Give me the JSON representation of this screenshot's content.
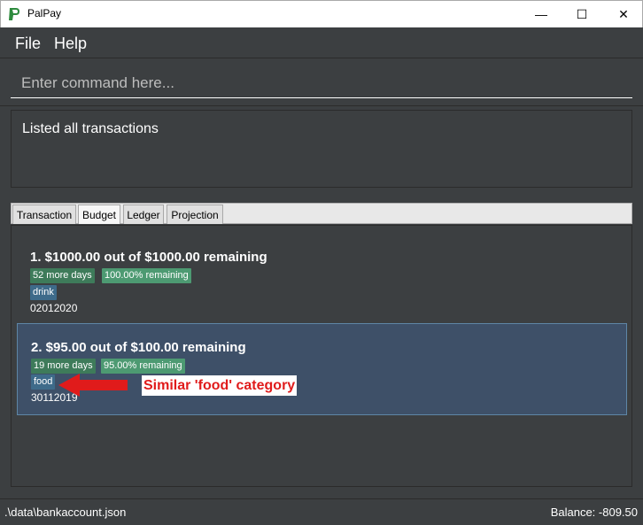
{
  "window": {
    "title": "PalPay",
    "minimize_glyph": "—",
    "maximize_glyph": "☐",
    "close_glyph": "✕"
  },
  "menu": {
    "file": "File",
    "help": "Help"
  },
  "command": {
    "placeholder": "Enter command here..."
  },
  "result": {
    "text": "Listed all transactions"
  },
  "tabs": [
    {
      "label": "Transaction"
    },
    {
      "label": "Budget"
    },
    {
      "label": "Ledger"
    },
    {
      "label": "Projection"
    }
  ],
  "budgets": [
    {
      "title": "1.  $1000.00 out of $1000.00 remaining",
      "days_left": "52 more days",
      "percent": "100.00% remaining",
      "category": "drink",
      "date": "02012020"
    },
    {
      "title": "2.  $95.00 out of $100.00 remaining",
      "days_left": "19 more days",
      "percent": "95.00% remaining",
      "category": "food",
      "date": "30112019"
    }
  ],
  "annotation": {
    "text": "Similar 'food' category",
    "color": "#e01b1b"
  },
  "status": {
    "path": ".\\data\\bankaccount.json",
    "balance": "Balance: -809.50"
  },
  "colors": {
    "background": "#3c3f41",
    "selected_card": "#3e5068",
    "tag_green": "#3e7b5a",
    "tag_blue": "#3e6b8a"
  }
}
